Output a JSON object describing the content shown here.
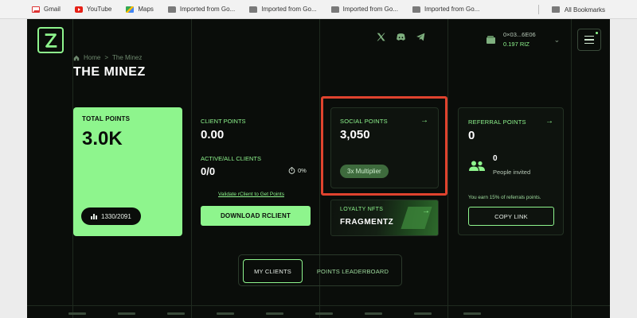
{
  "browser": {
    "bookmarks": [
      {
        "label": "Gmail",
        "icon": "gmail-icon"
      },
      {
        "label": "YouTube",
        "icon": "youtube-icon"
      },
      {
        "label": "Maps",
        "icon": "maps-icon"
      },
      {
        "label": "Imported from Go...",
        "icon": "folder-icon"
      },
      {
        "label": "Imported from Go...",
        "icon": "folder-icon"
      },
      {
        "label": "Imported from Go...",
        "icon": "folder-icon"
      },
      {
        "label": "Imported from Go...",
        "icon": "folder-icon"
      }
    ],
    "all_bookmarks": "All Bookmarks"
  },
  "header": {
    "breadcrumb": {
      "home": "Home",
      "separator": ">",
      "current": "The Minez"
    },
    "title": "THE MINEZ",
    "socials": [
      "x-icon",
      "discord-icon",
      "telegram-icon"
    ],
    "wallet": {
      "address": "0×03...6E06",
      "balance": "0.197 RIZ"
    }
  },
  "cards": {
    "total": {
      "label": "TOTAL POINTS",
      "value": "3.0K",
      "badge": "1330/2091"
    },
    "client": {
      "label": "CLIENT POINTS",
      "value": "0.00",
      "active_label": "ACTIVE/ALL CLIENTS",
      "active_value": "0/0",
      "percent": "0%",
      "validate_link": "Validate rClient to Get Points",
      "download_button": "DOWNLOAD RCLIENT"
    },
    "social": {
      "label": "SOCIAL POINTS",
      "value": "3,050",
      "multiplier": "3x Multiplier"
    },
    "loyalty": {
      "label": "LOYALTY NFTS",
      "value": "FRAGMENTZ"
    },
    "referral": {
      "label": "REFERRAL POINTS",
      "value": "0",
      "people_count": "0",
      "people_label": "People invited",
      "note": "You earn 15% of referrals points.",
      "copy_button": "COPY LINK"
    }
  },
  "tabs": [
    {
      "label": "MY CLIENTS",
      "active": true
    },
    {
      "label": "POINTS LEADERBOARD",
      "active": false
    }
  ],
  "colors": {
    "accent": "#8ef58d",
    "background": "#0a0d0a",
    "highlight": "#e0432e"
  }
}
